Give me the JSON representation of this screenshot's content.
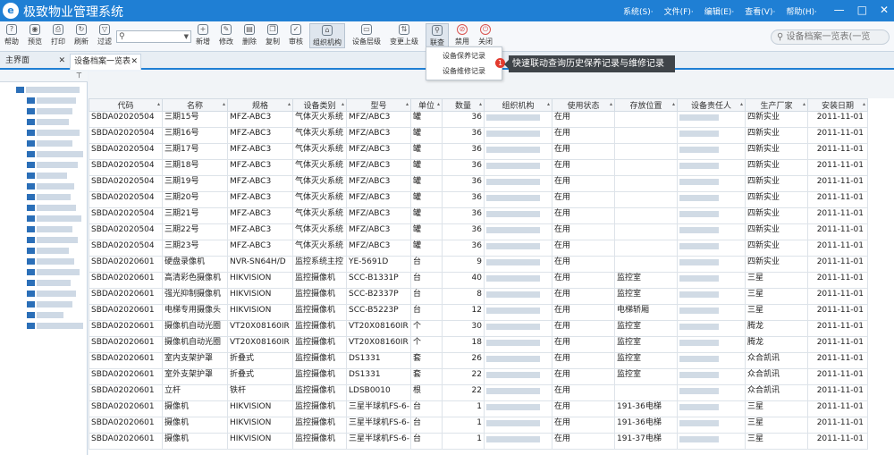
{
  "app": {
    "title": "极致物业管理系统",
    "logo_text": "e"
  },
  "menu": [
    "系统(S)·",
    "文件(F)·",
    "编辑(E)·",
    "查看(V)·",
    "帮助(H)·"
  ],
  "window_buttons": [
    "—",
    "□",
    "✕"
  ],
  "toolbar": {
    "buttons": [
      {
        "label": "帮助",
        "icon": "?"
      },
      {
        "label": "预览",
        "icon": "◉"
      },
      {
        "label": "打印",
        "icon": "⎙"
      },
      {
        "label": "刷新",
        "icon": "↻"
      },
      {
        "label": "过滤",
        "icon": "▽"
      },
      {
        "label": "新增",
        "icon": "+"
      },
      {
        "label": "修改",
        "icon": "✎"
      },
      {
        "label": "删除",
        "icon": "▤"
      },
      {
        "label": "复制",
        "icon": "❐"
      },
      {
        "label": "审核",
        "icon": "✓"
      },
      {
        "label": "组织机构",
        "icon": "⌂"
      },
      {
        "label": "设备层级",
        "icon": "▭"
      },
      {
        "label": "变更上级",
        "icon": "⇅"
      },
      {
        "label": "联查",
        "icon": "⚲"
      },
      {
        "label": "禁用",
        "icon": "⊘"
      },
      {
        "label": "关闭",
        "icon": "⏻"
      }
    ],
    "search_placeholder": "",
    "right_search": "设备档案一览表(一览"
  },
  "tabs": [
    {
      "label": "主界面",
      "close": "✕"
    },
    {
      "label": "设备档案一览表",
      "close": "✕"
    }
  ],
  "dropdown": {
    "items": [
      "设备保养记录",
      "设备维修记录"
    ]
  },
  "callout": {
    "badge": "1",
    "text": "快速联动查询历史保养记录与维修记录"
  },
  "left_panel": {
    "pin": "⊤"
  },
  "table": {
    "headers": [
      "代码",
      "名称",
      "规格",
      "设备类别",
      "型号",
      "单位",
      "数量",
      "组织机构",
      "使用状态",
      "存放位置",
      "设备责任人",
      "生产厂家",
      "安装日期"
    ],
    "rows": [
      [
        "SBDA02020504",
        "三期15号",
        "MFZ-ABC3",
        "气体灭火系统",
        "MFZ/ABC3",
        "罐",
        "36",
        "",
        "在用",
        "",
        "",
        "四新实业",
        "2011-11-01"
      ],
      [
        "SBDA02020504",
        "三期16号",
        "MFZ-ABC3",
        "气体灭火系统",
        "MFZ/ABC3",
        "罐",
        "36",
        "",
        "在用",
        "",
        "",
        "四新实业",
        "2011-11-01"
      ],
      [
        "SBDA02020504",
        "三期17号",
        "MFZ-ABC3",
        "气体灭火系统",
        "MFZ/ABC3",
        "罐",
        "36",
        "",
        "在用",
        "",
        "",
        "四新实业",
        "2011-11-01"
      ],
      [
        "SBDA02020504",
        "三期18号",
        "MFZ-ABC3",
        "气体灭火系统",
        "MFZ/ABC3",
        "罐",
        "36",
        "",
        "在用",
        "",
        "",
        "四新实业",
        "2011-11-01"
      ],
      [
        "SBDA02020504",
        "三期19号",
        "MFZ-ABC3",
        "气体灭火系统",
        "MFZ/ABC3",
        "罐",
        "36",
        "",
        "在用",
        "",
        "",
        "四新实业",
        "2011-11-01"
      ],
      [
        "SBDA02020504",
        "三期20号",
        "MFZ-ABC3",
        "气体灭火系统",
        "MFZ/ABC3",
        "罐",
        "36",
        "",
        "在用",
        "",
        "",
        "四新实业",
        "2011-11-01"
      ],
      [
        "SBDA02020504",
        "三期21号",
        "MFZ-ABC3",
        "气体灭火系统",
        "MFZ/ABC3",
        "罐",
        "36",
        "",
        "在用",
        "",
        "",
        "四新实业",
        "2011-11-01"
      ],
      [
        "SBDA02020504",
        "三期22号",
        "MFZ-ABC3",
        "气体灭火系统",
        "MFZ/ABC3",
        "罐",
        "36",
        "",
        "在用",
        "",
        "",
        "四新实业",
        "2011-11-01"
      ],
      [
        "SBDA02020504",
        "三期23号",
        "MFZ-ABC3",
        "气体灭火系统",
        "MFZ/ABC3",
        "罐",
        "36",
        "",
        "在用",
        "",
        "",
        "四新实业",
        "2011-11-01"
      ],
      [
        "SBDA02020601",
        "硬盘录像机",
        "NVR-SN64H/D",
        "监控系统主控",
        "YE-5691D",
        "台",
        "9",
        "",
        "在用",
        "",
        "",
        "四新实业",
        "2011-11-01"
      ],
      [
        "SBDA02020601",
        "高清彩色摄像机",
        "HIKVISION",
        "监控摄像机",
        "SCC-B1331P",
        "台",
        "40",
        "",
        "在用",
        "监控室",
        "",
        "三星",
        "2011-11-01"
      ],
      [
        "SBDA02020601",
        "强光抑制摄像机",
        "HIKVISION",
        "监控摄像机",
        "SCC-B2337P",
        "台",
        "8",
        "",
        "在用",
        "监控室",
        "",
        "三星",
        "2011-11-01"
      ],
      [
        "SBDA02020601",
        "电梯专用摄像头",
        "HIKVISION",
        "监控摄像机",
        "SCC-B5223P",
        "台",
        "12",
        "",
        "在用",
        "电梯轿厢",
        "",
        "三星",
        "2011-11-01"
      ],
      [
        "SBDA02020601",
        "摄像机自动光圈",
        "VT20X08160IR",
        "监控摄像机",
        "VT20X08160IR",
        "个",
        "30",
        "",
        "在用",
        "监控室",
        "",
        "腾龙",
        "2011-11-01"
      ],
      [
        "SBDA02020601",
        "摄像机自动光圈",
        "VT20X08160IR",
        "监控摄像机",
        "VT20X08160IR",
        "个",
        "18",
        "",
        "在用",
        "监控室",
        "",
        "腾龙",
        "2011-11-01"
      ],
      [
        "SBDA02020601",
        "室内支架护罩",
        "折叠式",
        "监控摄像机",
        "DS1331",
        "套",
        "26",
        "",
        "在用",
        "监控室",
        "",
        "众合凯讯",
        "2011-11-01"
      ],
      [
        "SBDA02020601",
        "室外支架护罩",
        "折叠式",
        "监控摄像机",
        "DS1331",
        "套",
        "22",
        "",
        "在用",
        "监控室",
        "",
        "众合凯讯",
        "2011-11-01"
      ],
      [
        "SBDA02020601",
        "立杆",
        "铁杆",
        "监控摄像机",
        "LDSB0010",
        "根",
        "22",
        "",
        "在用",
        "",
        "",
        "众合凯讯",
        "2011-11-01"
      ],
      [
        "SBDA02020601",
        "摄像机",
        "HIKVISION",
        "监控摄像机",
        "三星半球机FS-6-",
        "台",
        "1",
        "",
        "在用",
        "191-36电梯",
        "",
        "三星",
        "2011-11-01"
      ],
      [
        "SBDA02020601",
        "摄像机",
        "HIKVISION",
        "监控摄像机",
        "三星半球机FS-6-",
        "台",
        "1",
        "",
        "在用",
        "191-36电梯",
        "",
        "三星",
        "2011-11-01"
      ],
      [
        "SBDA02020601",
        "摄像机",
        "HIKVISION",
        "监控摄像机",
        "三星半球机FS-6-",
        "台",
        "1",
        "",
        "在用",
        "191-37电梯",
        "",
        "三星",
        "2011-11-01"
      ]
    ]
  }
}
